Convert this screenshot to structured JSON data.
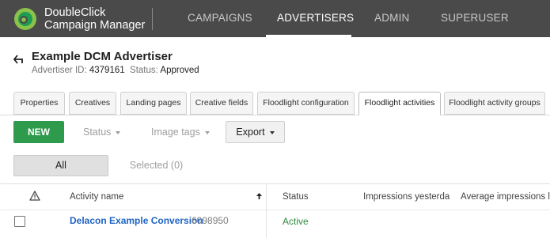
{
  "brand": {
    "line1": "DoubleClick",
    "line2": "Campaign Manager",
    "colors": {
      "ring_outer": "#8bc34a",
      "ring_inner": "#1e9c52"
    }
  },
  "nav": {
    "items": [
      {
        "label": "CAMPAIGNS",
        "active": false
      },
      {
        "label": "ADVERTISERS",
        "active": true
      },
      {
        "label": "ADMIN",
        "active": false
      },
      {
        "label": "SUPERUSER",
        "active": false
      }
    ]
  },
  "advertiser": {
    "name": "Example DCM Advertiser",
    "id_label": "Advertiser ID:",
    "id_value": "4379161",
    "status_label": "Status:",
    "status_value": "Approved"
  },
  "tabs": [
    {
      "label": "Properties",
      "active": false
    },
    {
      "label": "Creatives",
      "active": false
    },
    {
      "label": "Landing pages",
      "active": false
    },
    {
      "label": "Creative fields",
      "active": false
    },
    {
      "label": "Floodlight configuration",
      "active": false
    },
    {
      "label": "Floodlight activities",
      "active": true
    },
    {
      "label": "Floodlight activity groups",
      "active": false
    }
  ],
  "toolbar": {
    "new_label": "NEW",
    "status_label": "Status",
    "image_tags_label": "Image tags",
    "export_label": "Export"
  },
  "filter": {
    "all_label": "All",
    "selected_label": "Selected (0)"
  },
  "table": {
    "columns": [
      "Activity name",
      "Status",
      "Impressions yesterda",
      "Average impressions las"
    ],
    "rows": [
      {
        "name": "Delacon Example Conversion",
        "id": "6098950",
        "status": "Active"
      }
    ]
  },
  "colors": {
    "topbar": "#4a4a4a",
    "primary_button": "#2e9a4c",
    "link": "#1e63c4",
    "status_active": "#2e8b3c"
  }
}
